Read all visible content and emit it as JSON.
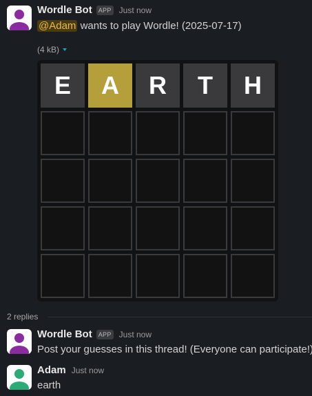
{
  "colors": {
    "background": "#1a1d21",
    "mention_bg": "#4a3b12",
    "mention_text": "#e8b84a",
    "tile_correct_position": "#b59f3b",
    "tile_absent": "#3a3a3c",
    "bot_avatar": "#8b2ba0",
    "user_avatar": "#2bac76"
  },
  "post": {
    "author": "Wordle Bot",
    "badge": "APP",
    "time": "Just now",
    "mention": "@Adam",
    "text": " wants to play Wordle! (2025-07-17)",
    "attachment_size": "(4 kB)"
  },
  "board": {
    "rows": 5,
    "cols": 5,
    "guesses": [
      [
        "E",
        "A",
        "R",
        "T",
        "H"
      ]
    ],
    "states": [
      [
        "absent",
        "present",
        "absent",
        "absent",
        "absent"
      ]
    ]
  },
  "thread": {
    "replies_label": "2 replies",
    "replies": [
      {
        "author": "Wordle Bot",
        "badge": "APP",
        "time": "Just now",
        "text": "Post your guesses in this thread! (Everyone can participate!)",
        "avatar": "bot-avatar"
      },
      {
        "author": "Adam",
        "badge": "",
        "time": "Just now",
        "text": "earth",
        "avatar": "user-avatar"
      }
    ]
  }
}
